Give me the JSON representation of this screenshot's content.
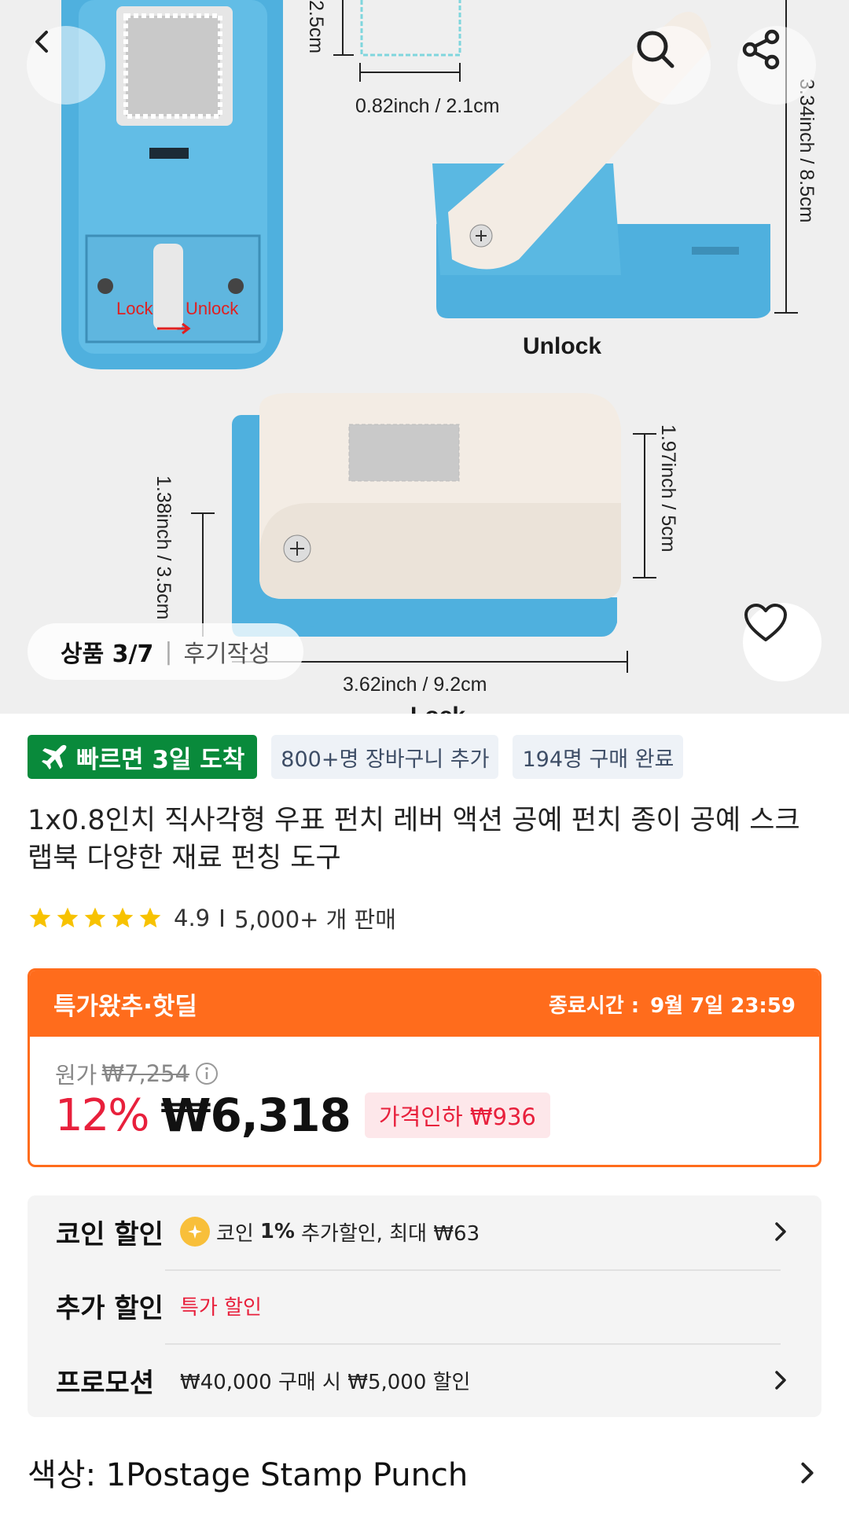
{
  "hero": {
    "dims": {
      "small_w": "0.82inch / 2.1cm",
      "small_h": "2.5cm",
      "height_top": "3.34inch / 8.5cm",
      "unlock_caption": "Unlock",
      "lock_label": "Lock",
      "unlock_label": "Unlock",
      "side_h": "1.97inch / 5cm",
      "left_h": "1.38inch / 3.5cm",
      "width_bottom": "3.62inch / 9.2cm",
      "lock_caption": "Lock"
    },
    "counter": "상품 3/7",
    "counter_sep": "|",
    "review": "후기작성"
  },
  "badges": {
    "fast": "빠르면 3일 도착",
    "cart": "800+명 장바구니 추가",
    "bought": "194명 구매 완료"
  },
  "product": {
    "title": "1x0.8인치 직사각형 우표 펀치 레버 액션 공예 펀치 종이 공예 스크랩북 다양한 재료 펀칭 도구",
    "rating": "4.9",
    "sold": "5,000+ 개 판매",
    "stars": 5
  },
  "deal": {
    "title": "특가왔추·핫딜",
    "end_label": "종료시간 :",
    "end_time": "9월 7일 23:59",
    "orig_label": "원가",
    "orig_price": "₩7,254",
    "discount": "12%",
    "price": "₩6,318",
    "cut": "가격인하 ₩936"
  },
  "discounts": {
    "coin_label": "코인 할인",
    "coin_pre": "코인",
    "coin_pct": "1%",
    "coin_post": "추가할인, 최대 ₩63",
    "extra_label": "추가 할인",
    "extra_val": "특가 할인",
    "promo_label": "프로모션",
    "promo_val": "₩40,000 구매 시 ₩5,000 할인"
  },
  "option": {
    "color": "색상: 1Postage Stamp Punch"
  },
  "colors": {
    "orange": "#ff6c1c",
    "red": "#e8203c",
    "green": "#098a3b",
    "punch_blue": "#4fb0de",
    "punch_cream": "#f3ece4"
  }
}
